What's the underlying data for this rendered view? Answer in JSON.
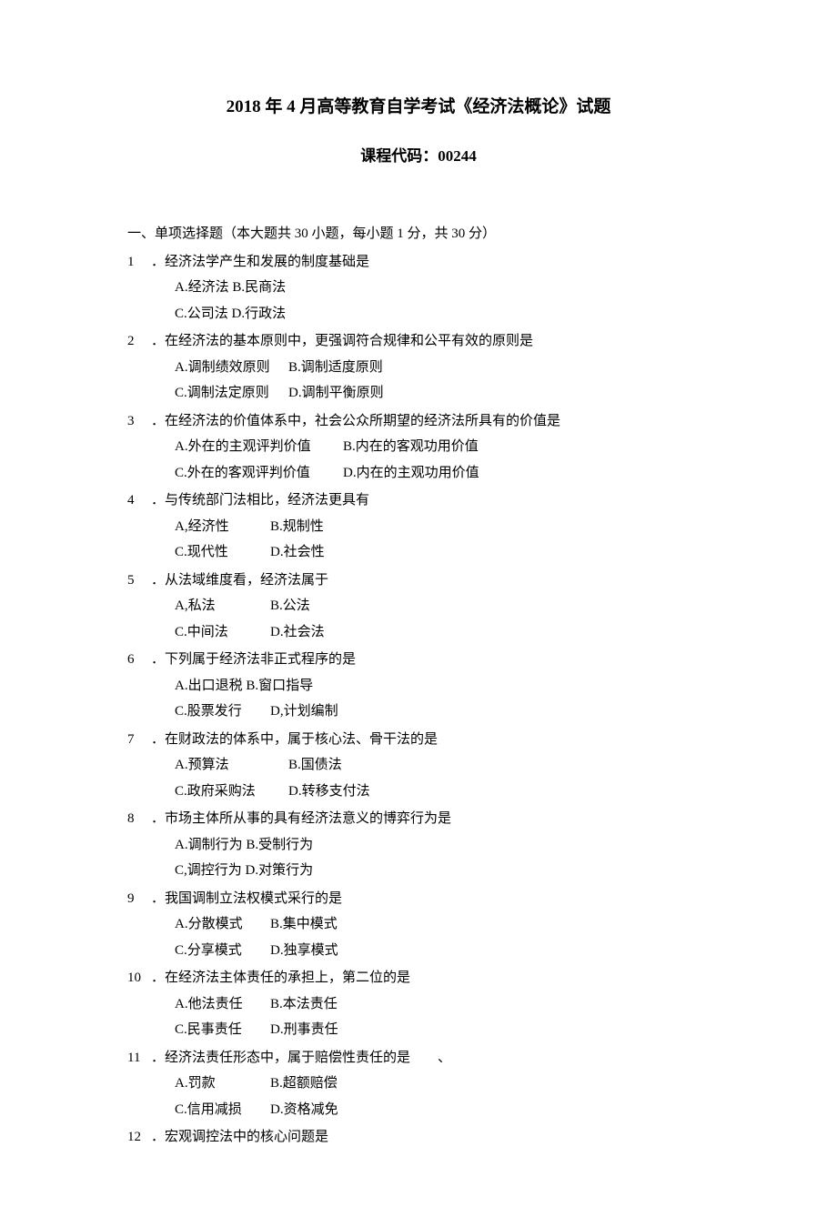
{
  "title_prefix": "2018",
  "title_mid1": " 年 ",
  "title_mid2": "4",
  "title_suffix": " 月高等教育自学考试《经济法概论》试题",
  "subtitle_label": "课程代码：",
  "subtitle_code": "00244",
  "section1_prefix": "一、单项选择题（本大题共 ",
  "section1_num1": "30",
  "section1_mid1": " 小题，每小题 ",
  "section1_num2": "1",
  "section1_mid2": " 分，共 ",
  "section1_num3": "30",
  "section1_suffix": " 分）",
  "questions": [
    {
      "num": "1",
      "stem": "．经济法学产生和发展的制度基础是",
      "rows": [
        [
          "A.经济法 B.民商法"
        ],
        [
          "C.公司法 D.行政法"
        ]
      ],
      "widths": [
        "w0"
      ]
    },
    {
      "num": "2",
      "stem": "．在经济法的基本原则中，更强调符合规律和公平有效的原则是",
      "rows": [
        [
          "A.调制绩效原则",
          "B.调制适度原则"
        ],
        [
          "C.调制法定原则",
          "D.调制平衡原则"
        ]
      ],
      "widths": [
        "w1",
        "w0"
      ]
    },
    {
      "num": "3",
      "stem": "．在经济法的价值体系中，社会公众所期望的经济法所具有的价值是",
      "rows": [
        [
          "A.外在的主观评判价值",
          "B.内在的客观功用价值"
        ],
        [
          "C.外在的客观评判价值",
          "D.内在的主观功用价值"
        ]
      ],
      "widths": [
        "w2",
        "w0"
      ]
    },
    {
      "num": "4",
      "stem": "．与传统部门法相比，经济法更具有",
      "rows": [
        [
          "A,经济性",
          "B.规制性"
        ],
        [
          "C.现代性",
          "D.社会性"
        ]
      ],
      "widths": [
        "w3",
        "w0"
      ]
    },
    {
      "num": "5",
      "stem": "．从法域维度看，经济法属于",
      "rows": [
        [
          "A,私法",
          "B.公法"
        ],
        [
          "C.中间法",
          "D.社会法"
        ]
      ],
      "widths": [
        "w3",
        "w0"
      ]
    },
    {
      "num": "6",
      "stem": "．下列属于经济法非正式程序的是",
      "rows": [
        [
          "A.出口退税 B.窗口指导"
        ],
        [
          "C.股票发行",
          "D,计划编制"
        ]
      ],
      "widths": [
        "w3",
        "w0"
      ]
    },
    {
      "num": "7",
      "stem": "．在财政法的体系中，属于核心法、骨干法的是",
      "rows": [
        [
          "A.预算法",
          "B.国债法"
        ],
        [
          "C.政府采购法",
          "D.转移支付法"
        ]
      ],
      "widths": [
        "w1",
        "w0"
      ]
    },
    {
      "num": "8",
      "stem": "．市场主体所从事的具有经济法意义的博弈行为是",
      "rows": [
        [
          "A.调制行为 B.受制行为"
        ],
        [
          "C,调控行为 D.对策行为"
        ]
      ],
      "widths": [
        "w0"
      ]
    },
    {
      "num": "9",
      "stem": "．我国调制立法权模式采行的是",
      "rows": [
        [
          "A.分散模式",
          "B.集中模式"
        ],
        [
          "C.分享模式",
          "D.独享模式"
        ]
      ],
      "widths": [
        "w3",
        "w0"
      ]
    },
    {
      "num": "10",
      "stem": "．在经济法主体责任的承担上，第二位的是",
      "rows": [
        [
          "A.他法责任",
          "B.本法责任"
        ],
        [
          "C.民事责任",
          "D.刑事责任"
        ]
      ],
      "widths": [
        "w3",
        "w0"
      ]
    },
    {
      "num": "11",
      "stem": "．经济法责任形态中，属于赔偿性责任的是　　、",
      "rows": [
        [
          "A.罚款",
          "B.超额赔偿"
        ],
        [
          "C.信用减损",
          "D.资格减免"
        ]
      ],
      "widths": [
        "w3",
        "w0"
      ]
    },
    {
      "num": "12",
      "stem": "．宏观调控法中的核心问题是",
      "rows": [],
      "widths": []
    }
  ]
}
